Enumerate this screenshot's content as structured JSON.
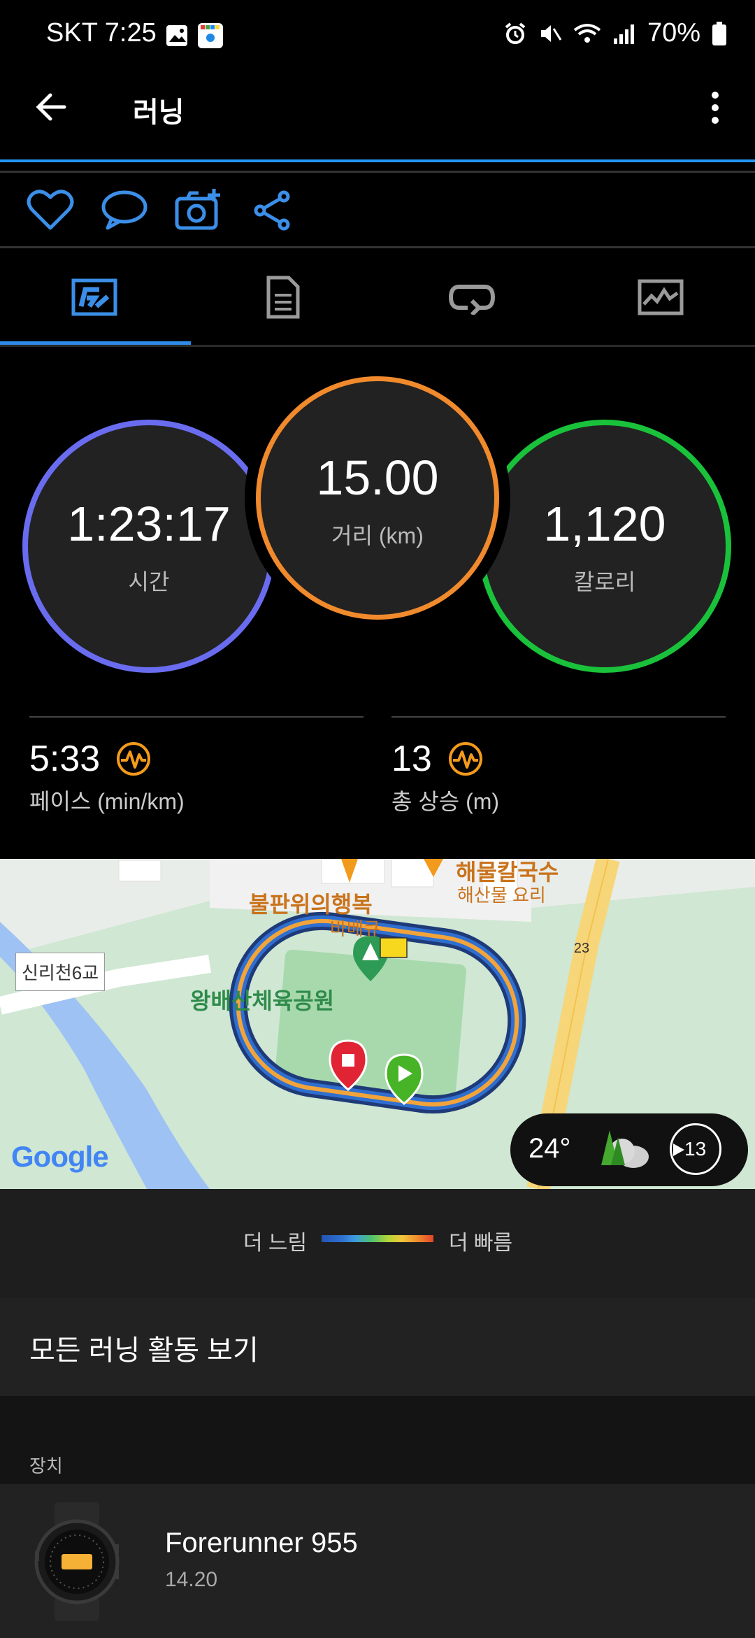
{
  "status_bar": {
    "carrier_time": "SKT 7:25",
    "battery": "70%"
  },
  "app_bar": {
    "title": "러닝"
  },
  "summary": {
    "time": {
      "value": "1:23:17",
      "label": "시간"
    },
    "distance": {
      "value": "15.00",
      "label": "거리 (km)"
    },
    "calories": {
      "value": "1,120",
      "label": "칼로리"
    },
    "pace": {
      "value": "5:33",
      "label": "페이스 (min/km)"
    },
    "ascent": {
      "value": "13",
      "label": "총 상승 (m)"
    }
  },
  "map": {
    "places": [
      {
        "name": "해물칼국수",
        "sub": "해산물 요리"
      },
      {
        "name": "불판위의행복",
        "sub": "바베큐"
      },
      {
        "name": "왕배산체육공원"
      },
      {
        "name": "신리천6교"
      }
    ],
    "road_badge": "23",
    "attribution": "Google",
    "weather": {
      "temp": "24°",
      "wind": "13"
    }
  },
  "legend": {
    "slower": "더 느림",
    "faster": "더 빠름"
  },
  "view_all_label": "모든 러닝 활동 보기",
  "device_section": {
    "header": "장치",
    "name": "Forerunner 955",
    "version": "14.20"
  },
  "colors": {
    "time_ring": "#6a6cf0",
    "distance_ring": "#f08a2c",
    "calories_ring": "#19c23a",
    "accent": "#2e8ce6",
    "stat_icon": "#f39a1b"
  },
  "icons": {
    "back": "arrow-left-icon",
    "menu": "more-vertical-icon",
    "like": "heart-icon",
    "comment": "comment-icon",
    "photo": "camera-add-icon",
    "share": "share-icon",
    "tab_stats": "activity-summary-icon",
    "tab_details": "document-icon",
    "tab_laps": "laps-loop-icon",
    "tab_charts": "chart-icon"
  }
}
